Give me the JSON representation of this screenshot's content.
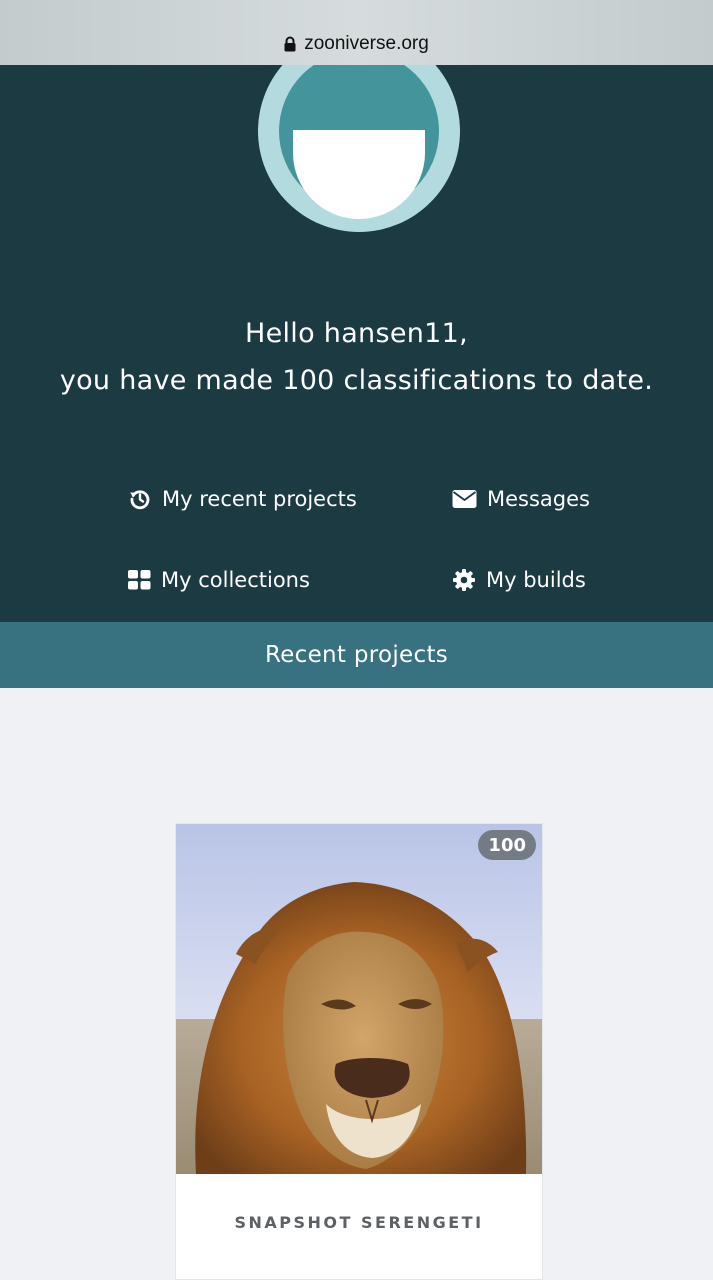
{
  "browser": {
    "url": "zooniverse.org",
    "lock_icon": "lock-icon"
  },
  "hero": {
    "greeting_line1": "Hello hansen11,",
    "greeting_line2": "you have made 100 classifications to date.",
    "avatar_icon": "zooniverse-avatar"
  },
  "nav": {
    "recent_projects": {
      "label": "My recent projects",
      "icon": "history-icon"
    },
    "messages": {
      "label": "Messages",
      "icon": "envelope-icon"
    },
    "collections": {
      "label": "My collections",
      "icon": "grid-icon"
    },
    "builds": {
      "label": "My builds",
      "icon": "gear-icon"
    }
  },
  "section": {
    "title": "Recent projects"
  },
  "projects": [
    {
      "name": "SNAPSHOT SERENGETI",
      "count": "100",
      "image": "lion-photo"
    }
  ],
  "colors": {
    "hero_bg": "#1b3a41",
    "section_bar": "#387280",
    "page_bg": "#eff1f4",
    "avatar_teal": "#44959b",
    "avatar_ring": "#b3dbdf"
  }
}
